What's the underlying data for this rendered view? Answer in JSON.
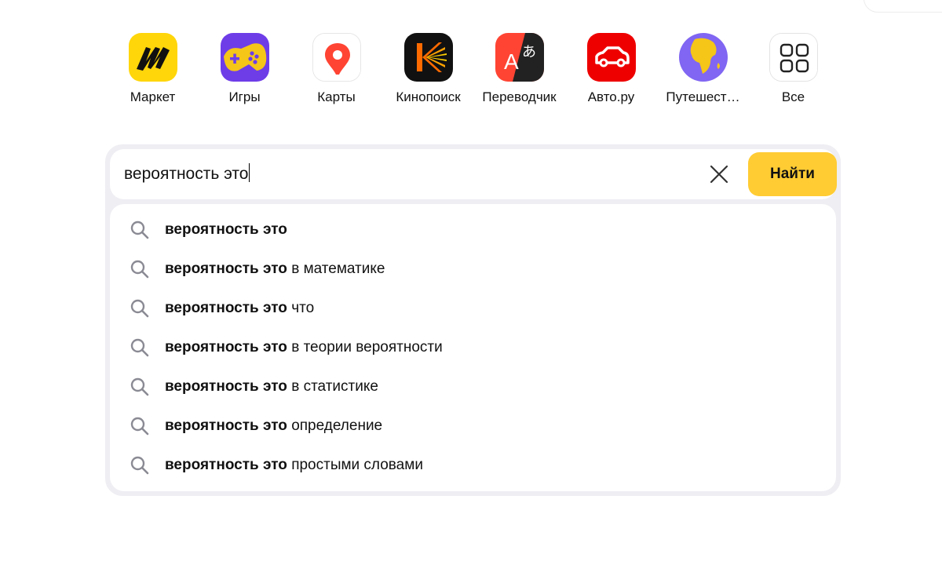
{
  "services": [
    {
      "label": "Маркет",
      "icon": "market-icon"
    },
    {
      "label": "Игры",
      "icon": "games-icon"
    },
    {
      "label": "Карты",
      "icon": "maps-icon"
    },
    {
      "label": "Кинопоиск",
      "icon": "kinopoisk-icon"
    },
    {
      "label": "Переводчик",
      "icon": "translator-icon"
    },
    {
      "label": "Авто.ру",
      "icon": "auto-ru-icon"
    },
    {
      "label": "Путешест…",
      "icon": "travel-icon"
    },
    {
      "label": "Все",
      "icon": "all-services-icon"
    }
  ],
  "search": {
    "query": "вероятность это",
    "button_label": "Найти",
    "clear_icon": "close-icon"
  },
  "suggestions": [
    {
      "bold": "вероятность это",
      "rest": ""
    },
    {
      "bold": "вероятность это",
      "rest": " в математике"
    },
    {
      "bold": "вероятность это",
      "rest": " что"
    },
    {
      "bold": "вероятность это",
      "rest": " в теории вероятности"
    },
    {
      "bold": "вероятность это",
      "rest": " в статистике"
    },
    {
      "bold": "вероятность это",
      "rest": " определение"
    },
    {
      "bold": "вероятность это",
      "rest": " простыми словами"
    }
  ],
  "colors": {
    "search_button": "#ffcc33",
    "search_frame": "#eeeef3",
    "suggest_icon": "#8a8a94"
  }
}
